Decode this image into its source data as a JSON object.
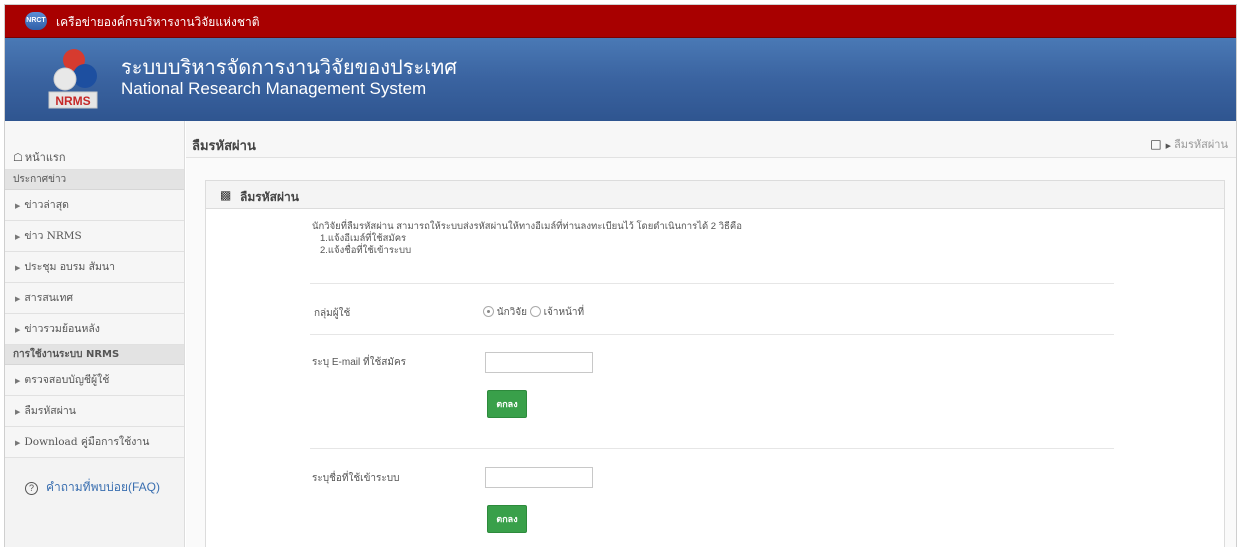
{
  "topbar": {
    "logo_text": "NRCT",
    "network_title": "เครือข่ายองค์กรบริหารงานวิจัยแห่งชาติ"
  },
  "banner": {
    "emblem_text": "NRMS",
    "title_th": "ระบบบริหารจัดการงานวิจัยของประเทศ",
    "title_en": "National Research Management System"
  },
  "sidebar": {
    "home_label": "หน้าแรก",
    "sections": [
      {
        "heading": "ประกาศข่าว",
        "items": [
          "ข่าวล่าสุด",
          "ข่าว NRMS",
          "ประชุม อบรม สัมนา",
          "สารสนเทศ",
          "ข่าวรวมย้อนหลัง"
        ]
      },
      {
        "heading": "การใช้งานระบบ NRMS",
        "items": [
          "ตรวจสอบบัญชีผู้ใช้",
          "ลืมรหัสผ่าน",
          "Download คู่มือการใช้งาน"
        ]
      }
    ],
    "faq_label": "คำถามที่พบบ่อย(FAQ)"
  },
  "page": {
    "title": "ลืมรหัสผ่าน",
    "breadcrumb": "ลืมรหัสผ่าน"
  },
  "panel": {
    "title": "ลืมรหัสผ่าน",
    "intro": "นักวิจัยที่ลืมรหัสผ่าน สามารถให้ระบบส่งรหัสผ่านให้ทางอีเมล์ที่ท่านลงทะเบียนไว้ โดยดำเนินการได้ 2 วิธีคือ",
    "method1": "1.แจ้งอีเมล์ที่ใช้สมัคร",
    "method2": "2.แจ้งชื่อที่ใช้เข้าระบบ",
    "group_label": "กลุ่มผู้ใช้",
    "group_options": [
      "นักวิจัย",
      "เจ้าหน้าที่"
    ],
    "group_selected": "นักวิจัย",
    "email_label": "ระบุ E-mail ที่ใช้สมัคร",
    "email_value": "",
    "username_label": "ระบุชื่อที่ใช้เข้าระบบ",
    "username_value": "",
    "submit_label": "ตกลง"
  },
  "colors": {
    "topbar": "#a80000",
    "banner": "#3a63a0",
    "button": "#39a04a",
    "faq_link": "#3a6fb0"
  }
}
